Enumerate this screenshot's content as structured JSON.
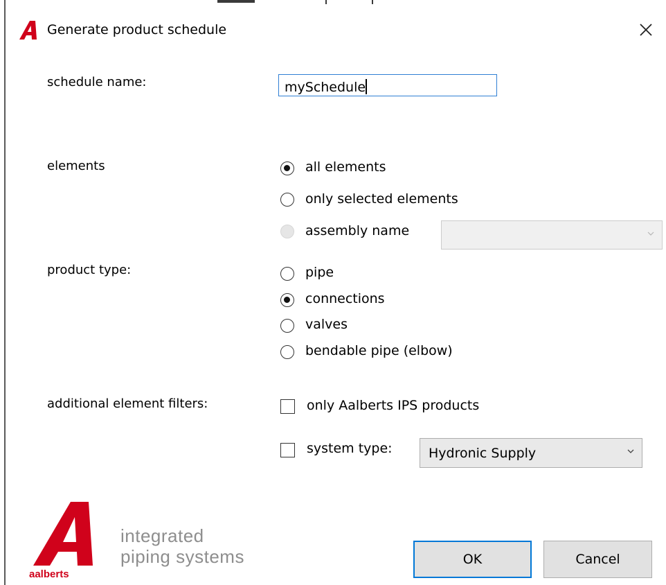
{
  "window": {
    "title": "Generate product schedule"
  },
  "schedule_name": {
    "label": "schedule name:",
    "value": "mySchedule"
  },
  "elements": {
    "label": "elements",
    "options": [
      {
        "label": "all elements",
        "checked": true,
        "enabled": true
      },
      {
        "label": "only selected elements",
        "checked": false,
        "enabled": true
      },
      {
        "label": "assembly name",
        "checked": false,
        "enabled": false
      }
    ],
    "assembly_value": ""
  },
  "product_type": {
    "label": "product type:",
    "options": [
      {
        "label": "pipe",
        "checked": false
      },
      {
        "label": "connections",
        "checked": true
      },
      {
        "label": "valves",
        "checked": false
      },
      {
        "label": "bendable pipe (elbow)",
        "checked": false
      }
    ]
  },
  "filters": {
    "label": "additional element filters:",
    "only_ips": {
      "label": "only Aalberts IPS products",
      "checked": false
    },
    "system_type": {
      "label": "system type:",
      "checked": false,
      "value": "Hydronic Supply"
    }
  },
  "brand": {
    "line1": "integrated",
    "line2": "piping systems",
    "wordmark": "aalberts",
    "color": "#d0021b"
  },
  "buttons": {
    "ok": "OK",
    "cancel": "Cancel"
  },
  "colors": {
    "accent": "#0078d7",
    "brand_red": "#d0021b"
  }
}
